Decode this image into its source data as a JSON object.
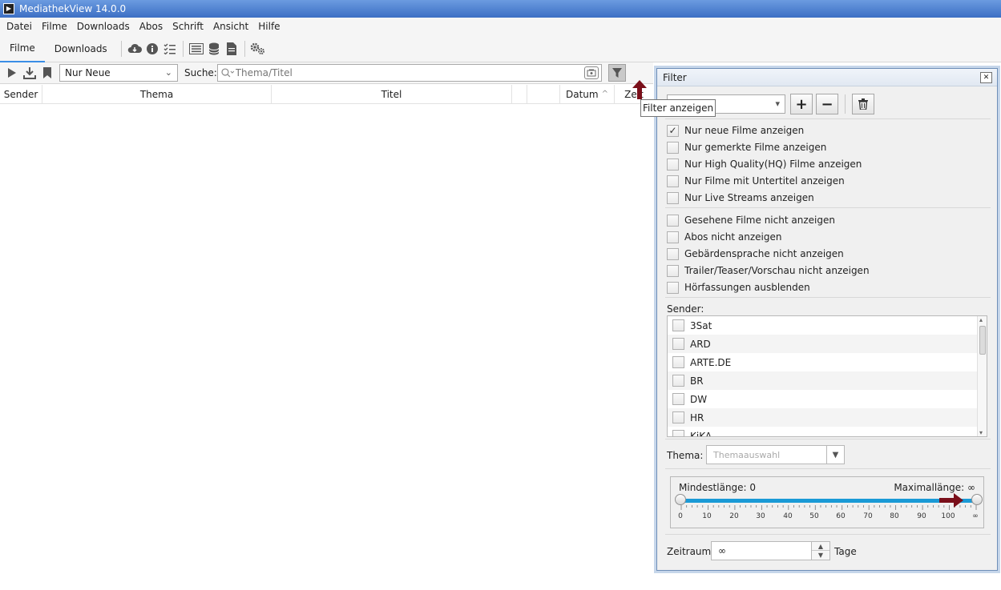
{
  "window": {
    "title": "MediathekView 14.0.0"
  },
  "menubar": [
    "Datei",
    "Filme",
    "Downloads",
    "Abos",
    "Schrift",
    "Ansicht",
    "Hilfe"
  ],
  "tabs": {
    "filme": "Filme",
    "downloads": "Downloads"
  },
  "actionbar": {
    "view_select": "Nur Neue",
    "search_label": "Suche:",
    "search_placeholder": "Thema/Titel"
  },
  "table": {
    "columns": [
      "Sender",
      "Thema",
      "Titel",
      "",
      "",
      "Datum",
      "Zeit"
    ]
  },
  "tooltip": "Filter anzeigen",
  "filter_panel": {
    "title": "Filter",
    "toggles_group1": [
      {
        "label": "Nur neue Filme anzeigen",
        "checked": true
      },
      {
        "label": "Nur gemerkte Filme anzeigen",
        "checked": false
      },
      {
        "label": "Nur High Quality(HQ) Filme anzeigen",
        "checked": false
      },
      {
        "label": "Nur Filme mit Untertitel anzeigen",
        "checked": false
      },
      {
        "label": "Nur Live Streams anzeigen",
        "checked": false
      }
    ],
    "toggles_group2": [
      {
        "label": "Gesehene Filme nicht anzeigen",
        "checked": false
      },
      {
        "label": "Abos nicht anzeigen",
        "checked": false
      },
      {
        "label": "Gebärdensprache nicht anzeigen",
        "checked": false
      },
      {
        "label": "Trailer/Teaser/Vorschau nicht anzeigen",
        "checked": false
      },
      {
        "label": "Hörfassungen ausblenden",
        "checked": false
      }
    ],
    "sender_label": "Sender:",
    "senders": [
      "3Sat",
      "ARD",
      "ARTE.DE",
      "BR",
      "DW",
      "HR",
      "KiKA"
    ],
    "thema_label": "Thema:",
    "thema_placeholder": "Themaauswahl",
    "min_length_label": "Mindestlänge: 0",
    "max_length_label": "Maximallänge: ∞",
    "slider_min_value": 0,
    "slider_max_value": "∞",
    "slider_ticks": [
      "0",
      "10",
      "20",
      "30",
      "40",
      "50",
      "60",
      "70",
      "80",
      "90",
      "100",
      "∞"
    ],
    "zeitraum_label": "Zeitraum:",
    "zeitraum_value": "∞",
    "tage_label": "Tage"
  },
  "colors": {
    "accent": "#1a9ad6",
    "annotation_arrow": "#7a0f1a",
    "titlebar": "#4a7fd0"
  }
}
